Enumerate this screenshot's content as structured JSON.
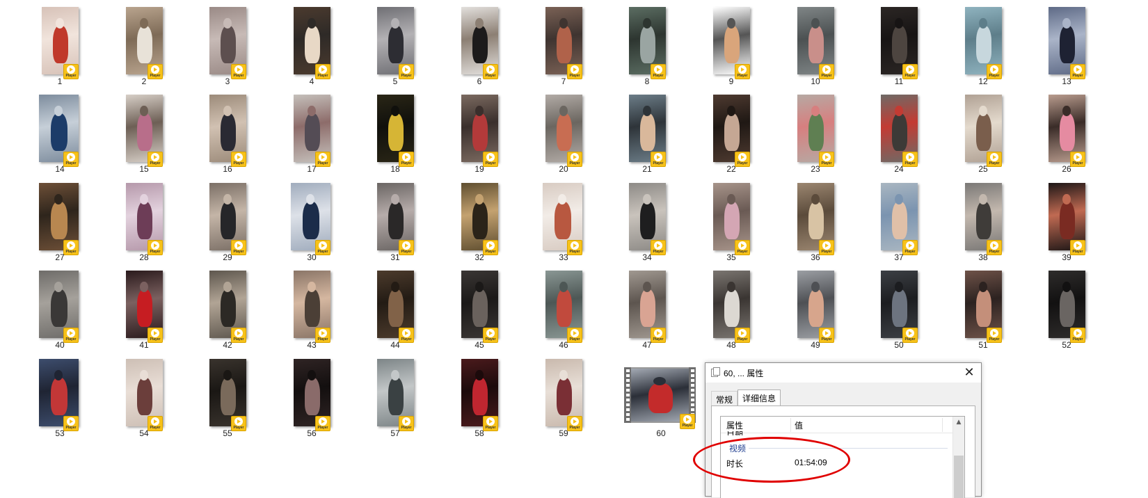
{
  "files": {
    "items": [
      {
        "label": "1",
        "colors": [
          "#d7c2b8",
          "#c0392b",
          "#f1e4dc"
        ]
      },
      {
        "label": "2",
        "colors": [
          "#b9a48e",
          "#e8e2d8",
          "#7e6b57"
        ]
      },
      {
        "label": "3",
        "colors": [
          "#9a8a86",
          "#5d4f4f",
          "#c7bab6"
        ]
      },
      {
        "label": "4",
        "colors": [
          "#4b3a2e",
          "#e8d8c6",
          "#2e2a27"
        ]
      },
      {
        "label": "5",
        "colors": [
          "#6f6f74",
          "#2d2d33",
          "#b3b1b4"
        ]
      },
      {
        "label": "6",
        "colors": [
          "#e2dfdc",
          "#1d1b1b",
          "#8c7f73"
        ]
      },
      {
        "label": "7",
        "colors": [
          "#7a6155",
          "#b0624a",
          "#3f3430"
        ]
      },
      {
        "label": "8",
        "colors": [
          "#5b6d62",
          "#9aa5a2",
          "#2d3530"
        ]
      },
      {
        "label": "9",
        "colors": [
          "#ffffff",
          "#d9a57b",
          "#555555"
        ]
      },
      {
        "label": "10",
        "colors": [
          "#7f8586",
          "#c98f8a",
          "#4c5152"
        ]
      },
      {
        "label": "11",
        "colors": [
          "#2b2624",
          "#4d4540",
          "#171414"
        ]
      },
      {
        "label": "12",
        "colors": [
          "#8fb3bf",
          "#c7d7dd",
          "#5e7e8a"
        ]
      },
      {
        "label": "13",
        "colors": [
          "#5e6a86",
          "#1e2233",
          "#aab4c8"
        ]
      },
      {
        "label": "14",
        "colors": [
          "#7d8c9d",
          "#1c3c69",
          "#c6cfd8"
        ]
      },
      {
        "label": "15",
        "colors": [
          "#d7cfc7",
          "#b86e8a",
          "#6d5f55"
        ]
      },
      {
        "label": "16",
        "colors": [
          "#9c8b7a",
          "#2a2a33",
          "#d1c1b2"
        ]
      },
      {
        "label": "17",
        "colors": [
          "#c5c0bb",
          "#544c55",
          "#8d6c6a"
        ]
      },
      {
        "label": "18",
        "colors": [
          "#2a2616",
          "#d6b535",
          "#10100c"
        ]
      },
      {
        "label": "19",
        "colors": [
          "#7b6a60",
          "#b33a3a",
          "#3a2f2c"
        ]
      },
      {
        "label": "20",
        "colors": [
          "#b2aba6",
          "#c86d52",
          "#6b6660"
        ]
      },
      {
        "label": "21",
        "colors": [
          "#6c7d88",
          "#d9b89b",
          "#2e3439"
        ]
      },
      {
        "label": "22",
        "colors": [
          "#4e3a30",
          "#c5a794",
          "#1f1814"
        ]
      },
      {
        "label": "23",
        "colors": [
          "#b6a9a3",
          "#5f7f52",
          "#d77f7f"
        ]
      },
      {
        "label": "24",
        "colors": [
          "#6e6a66",
          "#3d3a37",
          "#c33b33"
        ]
      },
      {
        "label": "25",
        "colors": [
          "#b0a194",
          "#7a5e4c",
          "#e4dacd"
        ]
      },
      {
        "label": "26",
        "colors": [
          "#b99c8e",
          "#e58ba1",
          "#3a2c28"
        ]
      },
      {
        "label": "27",
        "colors": [
          "#6d4f37",
          "#b88750",
          "#2e251c"
        ]
      },
      {
        "label": "28",
        "colors": [
          "#b598aa",
          "#6d3d57",
          "#e3d2de"
        ]
      },
      {
        "label": "29",
        "colors": [
          "#7b6f66",
          "#262629",
          "#c4b5a7"
        ]
      },
      {
        "label": "30",
        "colors": [
          "#a0acbd",
          "#1b2c4a",
          "#dde1e8"
        ]
      },
      {
        "label": "31",
        "colors": [
          "#6a6563",
          "#2a2828",
          "#b6acaa"
        ]
      },
      {
        "label": "32",
        "colors": [
          "#5f4e30",
          "#2b2419",
          "#c4a270"
        ]
      },
      {
        "label": "33",
        "colors": [
          "#d8cbc2",
          "#b85840",
          "#f2ece7"
        ]
      },
      {
        "label": "34",
        "colors": [
          "#8d8a86",
          "#1e1e1f",
          "#c9c3bc"
        ]
      },
      {
        "label": "35",
        "colors": [
          "#a7948a",
          "#d4a6b4",
          "#6a5a54"
        ]
      },
      {
        "label": "36",
        "colors": [
          "#9b8670",
          "#d8c3a4",
          "#5b4b3b"
        ]
      },
      {
        "label": "37",
        "colors": [
          "#a9b6c1",
          "#e0c0a8",
          "#7b94b0"
        ]
      },
      {
        "label": "38",
        "colors": [
          "#7a7876",
          "#3f3c39",
          "#c3b8ae"
        ]
      },
      {
        "label": "39",
        "colors": [
          "#1c1616",
          "#7a2b22",
          "#c06a52"
        ]
      },
      {
        "label": "40",
        "colors": [
          "#6e6c69",
          "#3a3837",
          "#a5a19b"
        ]
      },
      {
        "label": "41",
        "colors": [
          "#2a1a1c",
          "#c61d22",
          "#7b6160"
        ]
      },
      {
        "label": "42",
        "colors": [
          "#5e574e",
          "#2c2925",
          "#b1a495"
        ]
      },
      {
        "label": "43",
        "colors": [
          "#8a7567",
          "#4b3f36",
          "#d5b7a0"
        ]
      },
      {
        "label": "44",
        "colors": [
          "#4c3b2c",
          "#816248",
          "#231b14"
        ]
      },
      {
        "label": "45",
        "colors": [
          "#3a3634",
          "#6a625d",
          "#1b1918"
        ]
      },
      {
        "label": "46",
        "colors": [
          "#8a9794",
          "#c14a3d",
          "#4d5755"
        ]
      },
      {
        "label": "47",
        "colors": [
          "#a09890",
          "#d9a493",
          "#5d554f"
        ]
      },
      {
        "label": "48",
        "colors": [
          "#7a7570",
          "#dcd8d2",
          "#3a3532"
        ]
      },
      {
        "label": "49",
        "colors": [
          "#9b9ea3",
          "#d7a58c",
          "#4e5054"
        ]
      },
      {
        "label": "50",
        "colors": [
          "#3c3f44",
          "#6d7480",
          "#1c1d20"
        ]
      },
      {
        "label": "51",
        "colors": [
          "#6e5248",
          "#c48f7a",
          "#2c2220"
        ]
      },
      {
        "label": "52",
        "colors": [
          "#2e2c2b",
          "#6a6562",
          "#121111"
        ]
      },
      {
        "label": "53",
        "colors": [
          "#3d4d6d",
          "#c23737",
          "#1f2433"
        ]
      },
      {
        "label": "54",
        "colors": [
          "#cdbfb5",
          "#6b3e3b",
          "#e9ded6"
        ]
      },
      {
        "label": "55",
        "colors": [
          "#39332d",
          "#7a6a5b",
          "#1a1714"
        ]
      },
      {
        "label": "56",
        "colors": [
          "#2f2424",
          "#8a6b6a",
          "#130f0f"
        ]
      },
      {
        "label": "57",
        "colors": [
          "#7d8587",
          "#3a4143",
          "#c3c7c8"
        ]
      },
      {
        "label": "58",
        "colors": [
          "#4a1a1c",
          "#c02630",
          "#1c0a0b"
        ]
      },
      {
        "label": "59",
        "colors": [
          "#c9b9ad",
          "#7a2f35",
          "#e8dfd7"
        ]
      },
      {
        "label": "60",
        "colors": [
          "#a3a9b3",
          "#c32b2b",
          "#2b2f38"
        ]
      }
    ],
    "badge_text": "Player",
    "badge_color": "#f7c21a"
  },
  "dialog": {
    "title": "60, ... 属性",
    "close_glyph": "✕",
    "tabs": [
      "常规",
      "详细信息"
    ],
    "active_tab": 1,
    "columns": {
      "property": "属性",
      "value": "值"
    },
    "cut_row": "日期",
    "group": "视频",
    "rows": [
      {
        "name": "时长",
        "value": "01:54:09"
      }
    ],
    "scroll_up_glyph": "▲"
  },
  "highlight_color": "#e00000"
}
